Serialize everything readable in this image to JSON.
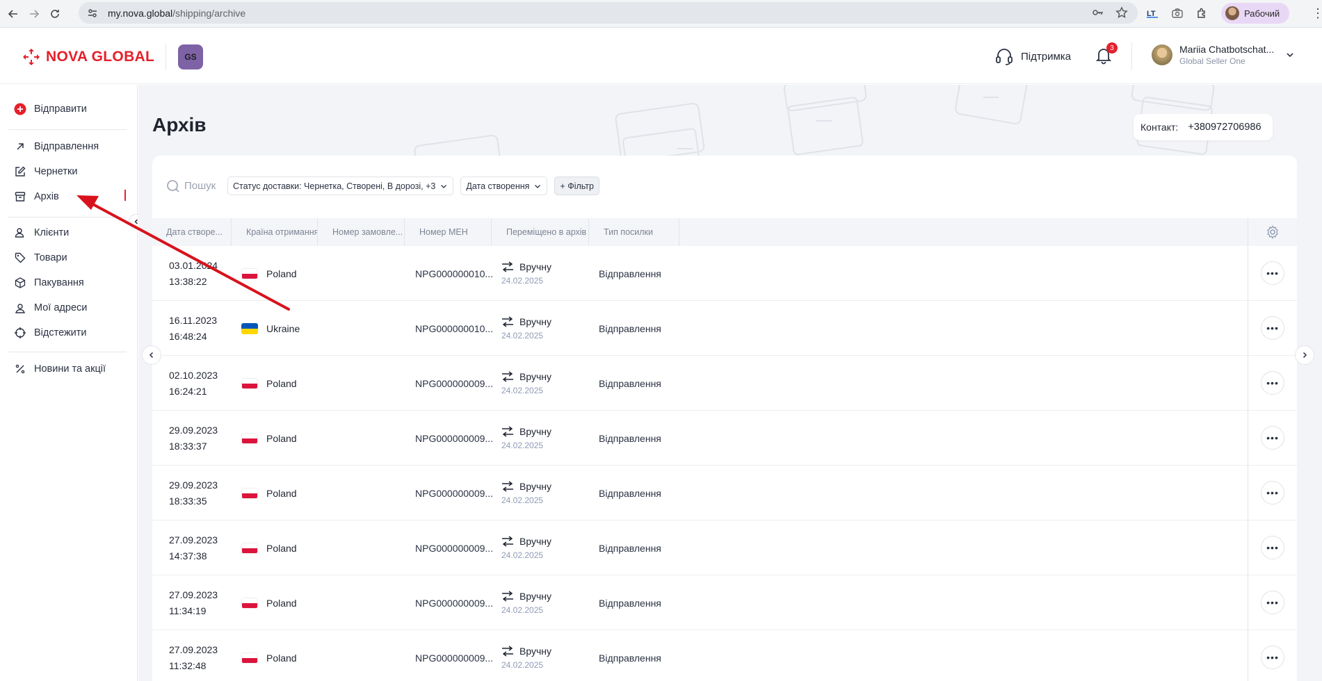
{
  "browser": {
    "url_host": "my.nova.global",
    "url_path": "/shipping/archive",
    "profile_label": "Рабочий"
  },
  "header": {
    "logo_text": "NOVA GLOBAL",
    "app_badge": "GS",
    "support_label": "Підтримка",
    "notifications_count": "3",
    "user_name": "Mariia Chatbotschat...",
    "user_org": "Global Seller One"
  },
  "sidebar": {
    "send_label": "Відправити",
    "items": [
      {
        "label": "Відправлення",
        "icon": "arrow-up-right-icon"
      },
      {
        "label": "Чернетки",
        "icon": "edit-icon"
      },
      {
        "label": "Архів",
        "icon": "archive-icon"
      },
      {
        "label": "Клієнти",
        "icon": "users-icon"
      },
      {
        "label": "Товари",
        "icon": "tag-icon"
      },
      {
        "label": "Пакування",
        "icon": "box-icon"
      },
      {
        "label": "Мої адреси",
        "icon": "location-icon"
      },
      {
        "label": "Відстежити",
        "icon": "crosshair-icon"
      },
      {
        "label": "Новини та акції",
        "icon": "percent-icon"
      }
    ]
  },
  "page": {
    "title": "Архів",
    "contact_label": "Контакт:",
    "contact_value": "+380972706986"
  },
  "filters": {
    "search_placeholder": "Пошук",
    "status_chip": "Статус доставки: Чернетка, Створені, В дорозі, +3",
    "date_chip": "Дата створення",
    "add_filter": "+ Фільтр"
  },
  "table": {
    "columns": [
      "Дата створе...",
      "Країна отримання",
      "Номер замовле...",
      "Номер МЕН",
      "Переміщено в архів",
      "Тип посилки"
    ],
    "rows": [
      {
        "date": "03.01.2024",
        "time": "13:38:22",
        "country": "Poland",
        "men": "NPG000000010...",
        "moved": "Вручну",
        "moved_date": "24.02.2025",
        "type": "Відправлення"
      },
      {
        "date": "16.11.2023",
        "time": "16:48:24",
        "country": "Ukraine",
        "men": "NPG000000010...",
        "moved": "Вручну",
        "moved_date": "24.02.2025",
        "type": "Відправлення"
      },
      {
        "date": "02.10.2023",
        "time": "16:24:21",
        "country": "Poland",
        "men": "NPG000000009...",
        "moved": "Вручну",
        "moved_date": "24.02.2025",
        "type": "Відправлення"
      },
      {
        "date": "29.09.2023",
        "time": "18:33:37",
        "country": "Poland",
        "men": "NPG000000009...",
        "moved": "Вручну",
        "moved_date": "24.02.2025",
        "type": "Відправлення"
      },
      {
        "date": "29.09.2023",
        "time": "18:33:35",
        "country": "Poland",
        "men": "NPG000000009...",
        "moved": "Вручну",
        "moved_date": "24.02.2025",
        "type": "Відправлення"
      },
      {
        "date": "27.09.2023",
        "time": "14:37:38",
        "country": "Poland",
        "men": "NPG000000009...",
        "moved": "Вручну",
        "moved_date": "24.02.2025",
        "type": "Відправлення"
      },
      {
        "date": "27.09.2023",
        "time": "11:34:19",
        "country": "Poland",
        "men": "NPG000000009...",
        "moved": "Вручну",
        "moved_date": "24.02.2025",
        "type": "Відправлення"
      },
      {
        "date": "27.09.2023",
        "time": "11:32:48",
        "country": "Poland",
        "men": "NPG000000009...",
        "moved": "Вручну",
        "moved_date": "24.02.2025",
        "type": "Відправлення"
      }
    ]
  },
  "colors": {
    "brand_red": "#e5202b",
    "poland_white": "#ffffff",
    "poland_red": "#dc143c",
    "ukraine_blue": "#0057b7",
    "ukraine_yellow": "#ffd700"
  }
}
